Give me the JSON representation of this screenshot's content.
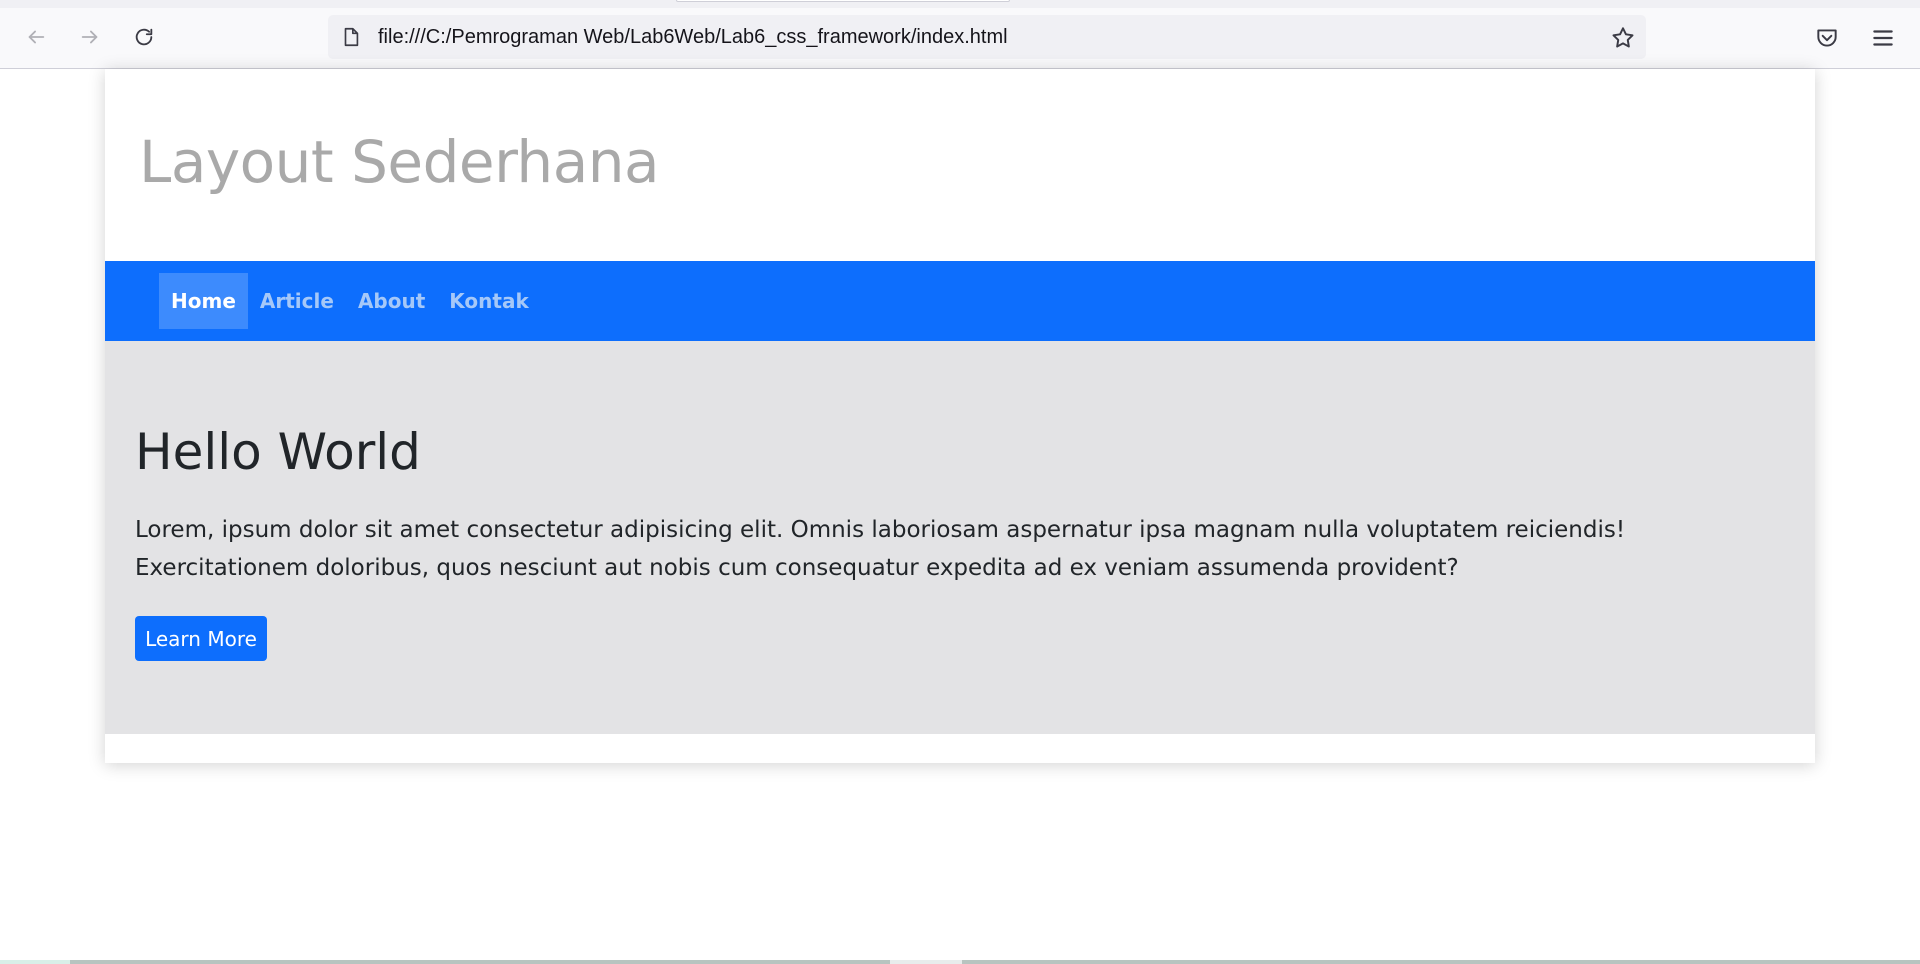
{
  "browser": {
    "url": "file:///C:/Pemrograman Web/Lab6Web/Lab6_css_framework/index.html",
    "icons": [
      "back-arrow-icon",
      "forward-arrow-icon",
      "reload-icon",
      "page-icon",
      "bookmark-star-icon",
      "pocket-icon",
      "hamburger-menu-icon"
    ]
  },
  "site": {
    "title": "Layout Sederhana",
    "nav": [
      {
        "label": "Home",
        "active": true
      },
      {
        "label": "Article",
        "active": false
      },
      {
        "label": "About",
        "active": false
      },
      {
        "label": "Kontak",
        "active": false
      }
    ]
  },
  "hero": {
    "title": "Hello World",
    "text": "Lorem, ipsum dolor sit amet consectetur adipisicing elit. Omnis laboriosam aspernatur ipsa magnam nulla voluptatem reiciendis! Exercitationem doloribus, quos nesciunt aut nobis cum consequatur expedita ad ex veniam assumenda provident?",
    "button_label": "Learn More"
  },
  "colors": {
    "primary": "#0d6efd",
    "hero_bg": "#e3e3e5",
    "title_gray": "#a9a9a9"
  }
}
